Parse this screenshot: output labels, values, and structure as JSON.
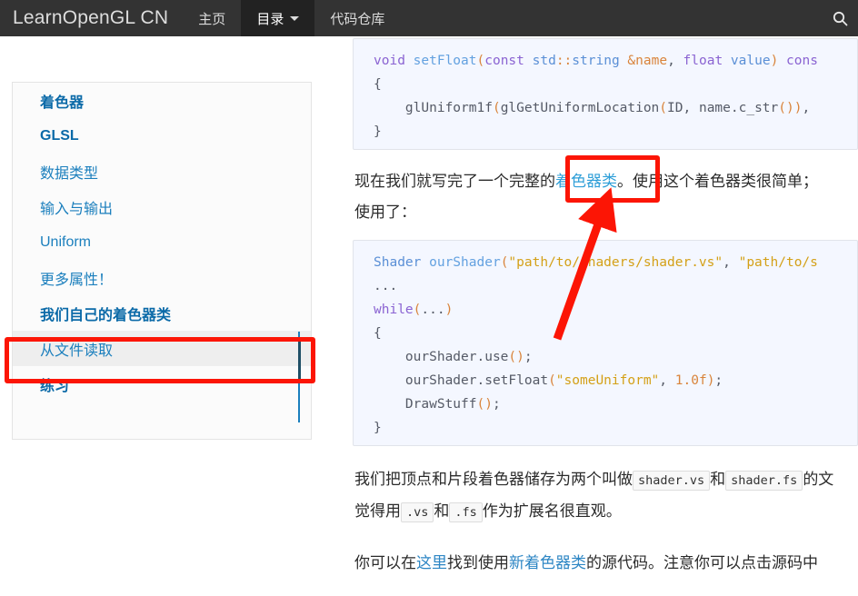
{
  "navbar": {
    "brand": "LearnOpenGL CN",
    "items": [
      {
        "label": "主页",
        "active": false
      },
      {
        "label": "目录",
        "active": true,
        "caret": true
      },
      {
        "label": "代码仓库",
        "active": false
      }
    ],
    "search_icon": "search-icon"
  },
  "sidebar": {
    "items": [
      {
        "label": "着色器",
        "level": 1
      },
      {
        "label": "GLSL",
        "level": 1
      },
      {
        "label": "数据类型",
        "level": 2
      },
      {
        "label": "输入与输出",
        "level": 2
      },
      {
        "label": "Uniform",
        "level": 2
      },
      {
        "label": "更多属性！",
        "level": 2
      },
      {
        "label": "我们自己的着色器类",
        "level": 1
      },
      {
        "label": "从文件读取",
        "level": 2,
        "current": true
      },
      {
        "label": "练习",
        "level": 1
      }
    ]
  },
  "content": {
    "code_top": {
      "lines": [
        [
          {
            "t": "void ",
            "c": "t-kw"
          },
          {
            "t": "setFloat",
            "c": "t-fn"
          },
          {
            "t": "(",
            "c": "t-pun"
          },
          {
            "t": "const ",
            "c": "t-kw"
          },
          {
            "t": "std",
            "c": "t-typ"
          },
          {
            "t": "::",
            "c": "t-pun"
          },
          {
            "t": "string ",
            "c": "t-typ"
          },
          {
            "t": "&name",
            "c": "t-pun"
          },
          {
            "t": ", ",
            "c": "t-pl"
          },
          {
            "t": "float ",
            "c": "t-kw"
          },
          {
            "t": "value",
            "c": "t-typ"
          },
          {
            "t": ")",
            "c": "t-pun"
          },
          {
            "t": " cons",
            "c": "t-kw"
          }
        ],
        [
          {
            "t": "{",
            "c": "t-pl"
          }
        ],
        [
          {
            "t": "    glUniform1f",
            "c": "t-pl"
          },
          {
            "t": "(",
            "c": "t-pun"
          },
          {
            "t": "glGetUniformLocation",
            "c": "t-pl"
          },
          {
            "t": "(",
            "c": "t-pun"
          },
          {
            "t": "ID",
            "c": "t-pl"
          },
          {
            "t": ", ",
            "c": "t-pl"
          },
          {
            "t": "name",
            "c": "t-pl"
          },
          {
            "t": ".c_str",
            "c": "t-pl"
          },
          {
            "t": "()",
            "c": "t-pun"
          },
          {
            "t": ")",
            "c": "t-pun"
          },
          {
            "t": ", ",
            "c": "t-pl"
          }
        ],
        [
          {
            "t": "}",
            "c": "t-pl"
          }
        ]
      ]
    },
    "para1": {
      "segments": [
        {
          "t": "现在我们就写完了一个完整的",
          "link": false
        },
        {
          "t": "着色器类",
          "link": true
        },
        {
          "t": "。使用这个着色器类很简单；",
          "link": false
        }
      ],
      "line2": "使用了："
    },
    "code_bottom": {
      "lines": [
        [
          {
            "t": "Shader ",
            "c": "t-typ"
          },
          {
            "t": "ourShader",
            "c": "t-fn"
          },
          {
            "t": "(",
            "c": "t-pun"
          },
          {
            "t": "\"path/to/shaders/shader.vs\"",
            "c": "t-str"
          },
          {
            "t": ", ",
            "c": "t-pl"
          },
          {
            "t": "\"path/to/s",
            "c": "t-str"
          }
        ],
        [
          {
            "t": "...",
            "c": "t-pl"
          }
        ],
        [
          {
            "t": "while",
            "c": "t-kw"
          },
          {
            "t": "(",
            "c": "t-pun"
          },
          {
            "t": "...",
            "c": "t-pl"
          },
          {
            "t": ")",
            "c": "t-pun"
          }
        ],
        [
          {
            "t": "{",
            "c": "t-pl"
          }
        ],
        [
          {
            "t": "    ourShader.use",
            "c": "t-pl"
          },
          {
            "t": "()",
            "c": "t-pun"
          },
          {
            "t": ";",
            "c": "t-pl"
          }
        ],
        [
          {
            "t": "    ourShader.setFloat",
            "c": "t-pl"
          },
          {
            "t": "(",
            "c": "t-pun"
          },
          {
            "t": "\"someUniform\"",
            "c": "t-str"
          },
          {
            "t": ", ",
            "c": "t-pl"
          },
          {
            "t": "1.0f",
            "c": "t-num"
          },
          {
            "t": ")",
            "c": "t-pun"
          },
          {
            "t": ";",
            "c": "t-pl"
          }
        ],
        [
          {
            "t": "    DrawStuff",
            "c": "t-pl"
          },
          {
            "t": "()",
            "c": "t-pun"
          },
          {
            "t": ";",
            "c": "t-pl"
          }
        ],
        [
          {
            "t": "}",
            "c": "t-pl"
          }
        ]
      ]
    },
    "para2": {
      "pre": "我们把顶点和片段着色器储存为两个叫做",
      "code1": "shader.vs",
      "mid": "和",
      "code2": "shader.fs",
      "post": "的文",
      "line2_pre": "觉得用",
      "line2_code1": ".vs",
      "line2_mid": "和",
      "line2_code2": ".fs",
      "line2_post": "作为扩展名很直观。"
    },
    "para3": {
      "seg1": "你可以在",
      "link1": "这里",
      "seg2": "找到使用",
      "link2": "新着色器类",
      "seg3": "的源代码。注意你可以点击源码中"
    }
  },
  "annotations": {
    "box_sidebar_name": "highlight-box-sidebar-item",
    "box_text_name": "highlight-box-link",
    "arrow_name": "annotation-arrow",
    "color": "#fc1505"
  }
}
